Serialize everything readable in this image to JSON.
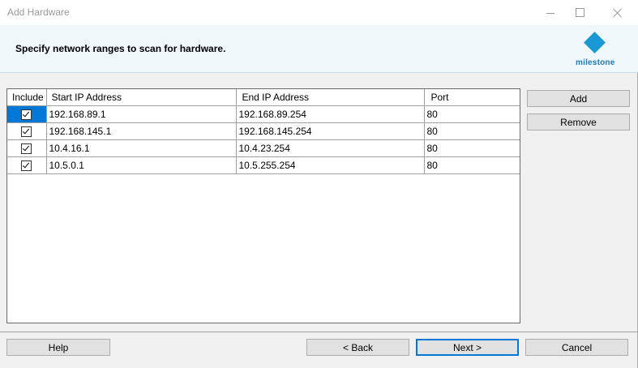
{
  "window": {
    "title": "Add Hardware"
  },
  "header": {
    "instruction": "Specify network ranges to scan for hardware.",
    "logo_text": "milestone"
  },
  "table": {
    "columns": [
      "Include",
      "Start IP Address",
      "End IP Address",
      "Port"
    ],
    "rows": [
      {
        "include": true,
        "start": "192.168.89.1",
        "end": "192.168.89.254",
        "port": "80"
      },
      {
        "include": true,
        "start": "192.168.145.1",
        "end": "192.168.145.254",
        "port": "80"
      },
      {
        "include": true,
        "start": "10.4.16.1",
        "end": "10.4.23.254",
        "port": "80"
      },
      {
        "include": true,
        "start": "10.5.0.1",
        "end": "10.5.255.254",
        "port": "80"
      }
    ]
  },
  "side_buttons": {
    "add": "Add",
    "remove": "Remove"
  },
  "footer_buttons": {
    "help": "Help",
    "back": "< Back",
    "next": "Next >",
    "cancel": "Cancel"
  },
  "colors": {
    "selection": "#0078d7",
    "header_band": "#eff7fa",
    "logo": "#1a98d5"
  }
}
